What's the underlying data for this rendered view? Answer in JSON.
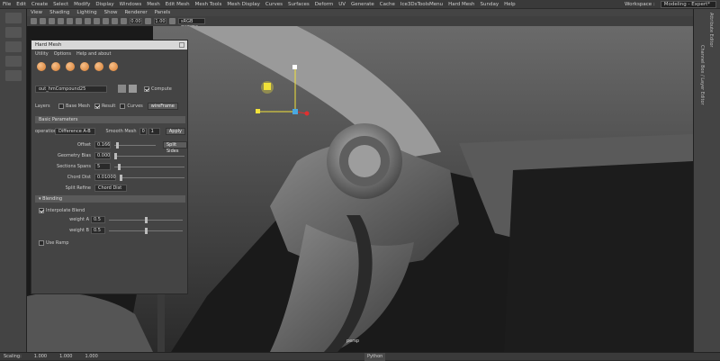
{
  "menu": {
    "items": [
      "File",
      "Edit",
      "Create",
      "Select",
      "Modify",
      "Display",
      "Windows",
      "Mesh",
      "Edit Mesh",
      "Mesh Tools",
      "Mesh Display",
      "Curves",
      "Surfaces",
      "Deform",
      "UV",
      "Generate",
      "Cache",
      "Ice3DsToolsMenu",
      "Hard Mesh",
      "Sunday",
      "Help"
    ],
    "workspace_label": "Workspace :",
    "workspace_value": "Modeling - Expert*"
  },
  "viewport_menu": [
    "View",
    "Shading",
    "Lighting",
    "Show",
    "Renderer",
    "Panels"
  ],
  "toolbar": {
    "field1": "0.00",
    "field2": "1.00",
    "colorspace": "sRGB gamma"
  },
  "right_tabs": [
    "Channel Box / Layer Editor",
    "Attribute Editor"
  ],
  "viewport_label": "persp",
  "panel": {
    "title": "Hard Mesh",
    "menu": [
      "Utility",
      "Options",
      "Help and about"
    ],
    "object_value": "out_hmCompound25",
    "compute_label": "Compute",
    "layers_label": "Layers",
    "base_mesh": "Base Mesh",
    "result": "Result",
    "curves": "Curves",
    "wireframe": "wireFrame",
    "basic_params": "Basic Parameters",
    "operation_label": "operation",
    "operation_value": "Difference A-B",
    "smooth_label": "Smooth Mesh",
    "smooth_value": "0",
    "smooth_value2": "1",
    "apply": "Apply",
    "offset_label": "Offset",
    "offset_value": "0.166",
    "split_sides": "Split Sides",
    "geo_bias_label": "Geometry Bias",
    "geo_bias_value": "0.000",
    "sections_label": "Sections Spans",
    "sections_value": "5",
    "chord_label": "Chord Dist",
    "chord_value": "0.01000",
    "split_refine_label": "Split Refine",
    "split_refine_value": "Chord Dist",
    "blending": "Blending",
    "interp_label": "Interpolate Blend",
    "weight_a_label": "weight A",
    "weight_a_value": "0.5",
    "weight_a": 0.5,
    "weight_b_label": "weight B",
    "weight_b_value": "0.5",
    "weight_b": 0.5,
    "ramp_label": "Use Ramp"
  },
  "status": {
    "scaling": "Scaling:",
    "v1": "1.000",
    "v2": "1.000",
    "v3": "1.000",
    "python": "Python"
  }
}
